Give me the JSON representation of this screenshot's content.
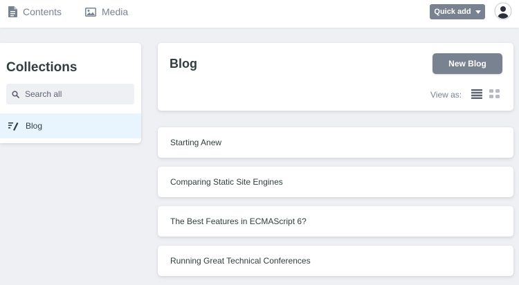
{
  "header": {
    "nav": {
      "contents_label": "Contents",
      "media_label": "Media"
    },
    "quick_add_label": "Quick add"
  },
  "sidebar": {
    "title": "Collections",
    "search": {
      "placeholder": "Search all",
      "value": ""
    },
    "items": [
      {
        "label": "Blog",
        "active": true
      }
    ]
  },
  "main": {
    "collection_title": "Blog",
    "new_button_label": "New Blog",
    "view_as_label": "View as:",
    "entries": [
      {
        "title": "Starting Anew"
      },
      {
        "title": "Comparing Static Site Engines"
      },
      {
        "title": "The Best Features in ECMAScript 6?"
      },
      {
        "title": "Running Great Technical Conferences"
      }
    ]
  },
  "icons": {
    "contents": "document-icon",
    "media": "image-icon",
    "avatar": "user-avatar-icon",
    "search": "search-icon",
    "collection": "write-icon",
    "list_view": "list-view-icon",
    "grid_view": "grid-view-icon"
  },
  "colors": {
    "background": "#eff0f4",
    "card": "#ffffff",
    "button": "#798291",
    "text": "#313d3e",
    "muted_text": "#798291",
    "active_item": "#e8f5fe"
  }
}
